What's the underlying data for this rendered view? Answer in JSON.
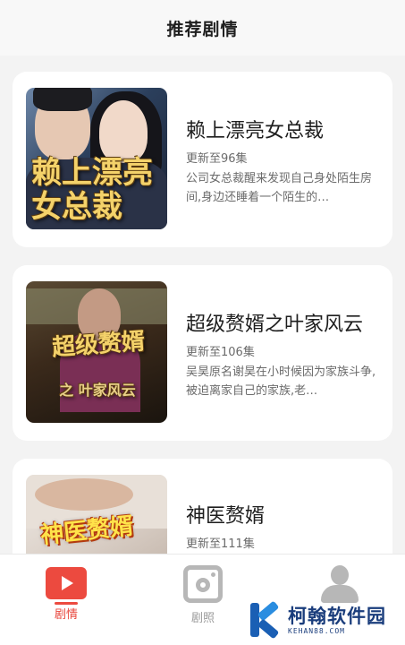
{
  "header": {
    "title": "推荐剧情"
  },
  "dramas": [
    {
      "title": "赖上漂亮女总裁",
      "update": "更新至96集",
      "desc": "公司女总裁醒来发现自己身处陌生房间,身边还睡着一个陌生的…",
      "poster_text": "赖上漂亮女总裁"
    },
    {
      "title": "超级赘婿之叶家风云",
      "update": "更新至106集",
      "desc": "吴昊原名谢昊在小时候因为家族斗争,被迫离家自己的家族,老…",
      "poster_text": "超级赘婿",
      "poster_subtext": "之 叶家风云"
    },
    {
      "title": "神医赘婿",
      "update": "更新至111集",
      "desc": "",
      "poster_text": "神医赘婿"
    }
  ],
  "tabbar": {
    "tabs": [
      {
        "label": "剧情",
        "icon": "play-icon",
        "active": true
      },
      {
        "label": "剧照",
        "icon": "photo-icon",
        "active": false
      },
      {
        "label": "",
        "icon": "user-icon",
        "active": false
      }
    ]
  },
  "watermark": {
    "name": "柯翰软件园",
    "url": "KEHAN88.COM"
  },
  "colors": {
    "accent": "#ec4a3f",
    "inactive": "#b7b7b7",
    "card_bg": "#ffffff",
    "page_bg": "#f3f3f3"
  }
}
